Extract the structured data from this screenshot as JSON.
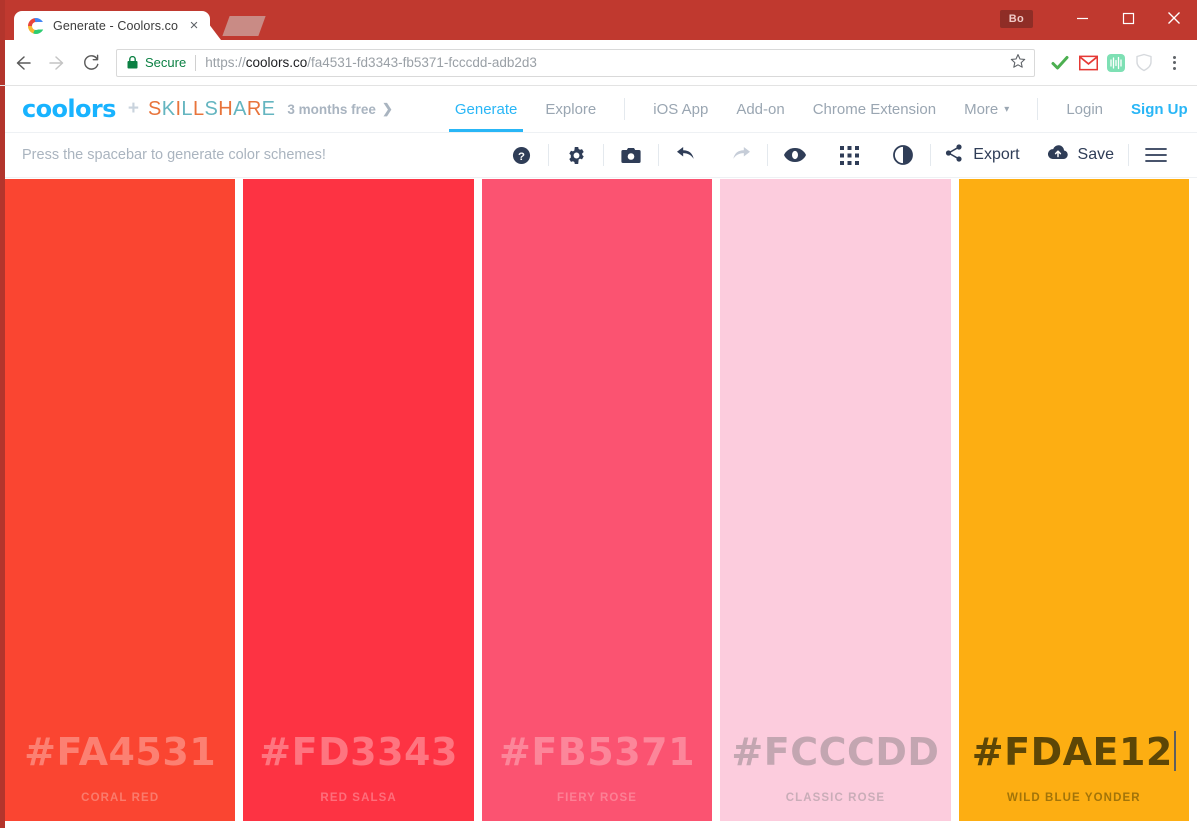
{
  "browser": {
    "tab": {
      "title": "Generate - Coolors.co",
      "favicon": "coolors-favicon",
      "close": "×"
    },
    "new_tab_label": "new-tab",
    "profile": "Bo",
    "window_controls": {
      "minimize": "minimize",
      "maximize": "maximize",
      "close": "close"
    },
    "nav": {
      "back": "back",
      "forward": "forward",
      "reload": "reload"
    },
    "omnibox": {
      "security_label": "Secure",
      "url_scheme": "https://",
      "url_host": "coolors.co",
      "url_path": "/fa4531-fd3343-fb5371-fcccdd-adb2d3",
      "full_url": "https://coolors.co/fa4531-fd3343-fb5371-fcccdd-adb2d3",
      "bookmark": "star-icon"
    },
    "extensions": [
      "check-icon",
      "gmail-icon",
      "audio-waveform-icon",
      "shield-icon"
    ],
    "menu": "chrome-menu"
  },
  "site_header": {
    "brand": "coolors",
    "plus": "+",
    "partner": "SKILLSHARE",
    "promo": "3 months free",
    "promo_arrow": "❯",
    "nav_left": [
      {
        "label": "Generate",
        "active": true
      },
      {
        "label": "Explore",
        "active": false
      }
    ],
    "nav_mid": [
      {
        "label": "iOS App"
      },
      {
        "label": "Add-on"
      },
      {
        "label": "Chrome Extension"
      },
      {
        "label": "More"
      }
    ],
    "more_caret": "▾",
    "nav_right": [
      {
        "label": "Login",
        "highlight": false
      },
      {
        "label": "Sign Up",
        "highlight": true
      }
    ]
  },
  "app_toolbar": {
    "hint": "Press the spacebar to generate color schemes!",
    "icons": [
      {
        "name": "help-icon"
      },
      {
        "name": "settings-gear-icon"
      },
      {
        "name": "camera-icon"
      },
      {
        "name": "undo-icon"
      },
      {
        "name": "redo-icon"
      },
      {
        "name": "view-icon"
      },
      {
        "name": "grid-icon"
      },
      {
        "name": "contrast-icon"
      }
    ],
    "export_label": "Export",
    "save_label": "Save",
    "menu_label": "hamburger-menu"
  },
  "palette": {
    "swatches": [
      {
        "hex": "#FA4531",
        "name": "CORAL RED",
        "bg": "#FA4531",
        "text": "#fc8072",
        "subtext": "#fa7b6c",
        "editing": false
      },
      {
        "hex": "#FD3343",
        "name": "RED SALSA",
        "bg": "#FD3343",
        "text": "#fe7580",
        "subtext": "#fe6e7b",
        "editing": false
      },
      {
        "hex": "#FB5371",
        "name": "FIERY ROSE",
        "bg": "#FB5371",
        "text": "#fc869a",
        "subtext": "#fc8095",
        "editing": false
      },
      {
        "hex": "#FCCCDD",
        "name": "CLASSIC ROSE",
        "bg": "#FCCCDD",
        "text": "#c3a6b1",
        "subtext": "#c9adb8",
        "editing": false
      },
      {
        "hex": "#FDAE12",
        "name": "WILD BLUE YONDER",
        "bg": "#FDAE12",
        "text": "#5d4606",
        "subtext": "#a27409",
        "editing": true
      }
    ]
  }
}
